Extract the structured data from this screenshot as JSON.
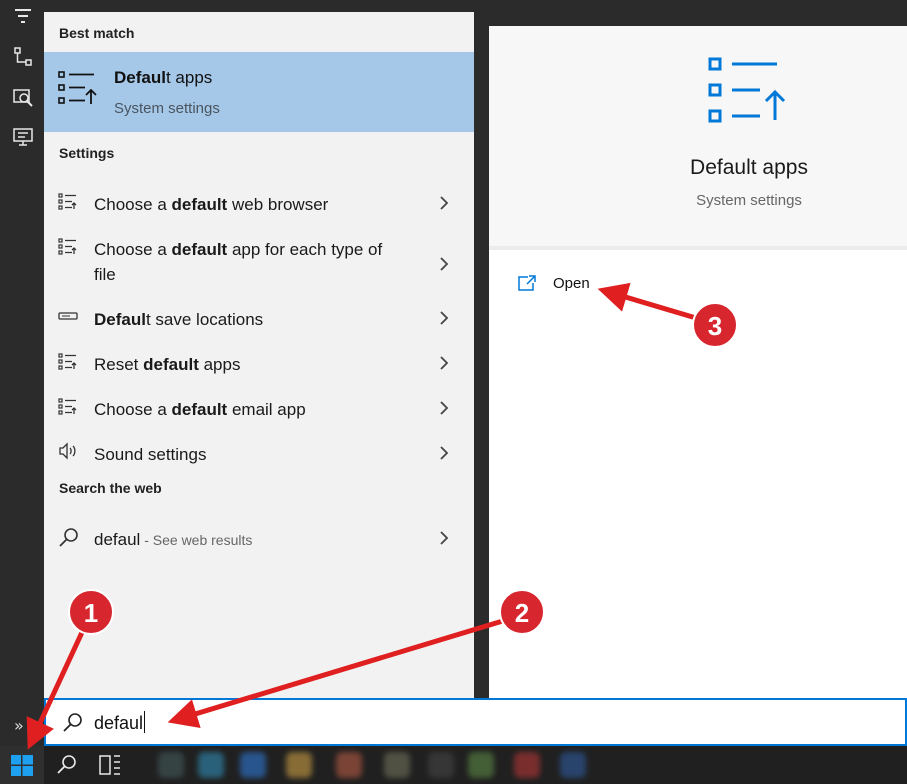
{
  "results": {
    "best_match_heading": "Best match",
    "best": {
      "title_bold": "Defaul",
      "title_rest": "t apps",
      "subtitle": "System settings"
    },
    "settings_heading": "Settings",
    "settings_items": [
      {
        "pre": "Choose a ",
        "bold": "default",
        "post": " web browser",
        "icon": "list-settings-icon"
      },
      {
        "pre": "Choose a ",
        "bold": "default",
        "post": " app for each type of file",
        "icon": "list-settings-icon"
      },
      {
        "pre": "",
        "bold": "Defaul",
        "post": "t save locations",
        "icon": "drive-icon"
      },
      {
        "pre": "Reset ",
        "bold": "default",
        "post": " apps",
        "icon": "list-settings-icon"
      },
      {
        "pre": "Choose a ",
        "bold": "default",
        "post": " email app",
        "icon": "list-settings-icon"
      },
      {
        "pre": "",
        "bold": "",
        "post": "Sound settings",
        "icon": "speaker-icon"
      }
    ],
    "web_heading": "Search the web",
    "web_item": {
      "query": "defaul",
      "suffix": " - See web results"
    }
  },
  "details": {
    "title": "Default apps",
    "subtitle": "System settings",
    "open_label": "Open"
  },
  "search": {
    "value": "defaul"
  },
  "annotations": [
    "1",
    "2",
    "3"
  ],
  "colors": {
    "accent": "#0078d7",
    "highlight": "#a6c8e8",
    "annotation": "#e02020"
  }
}
